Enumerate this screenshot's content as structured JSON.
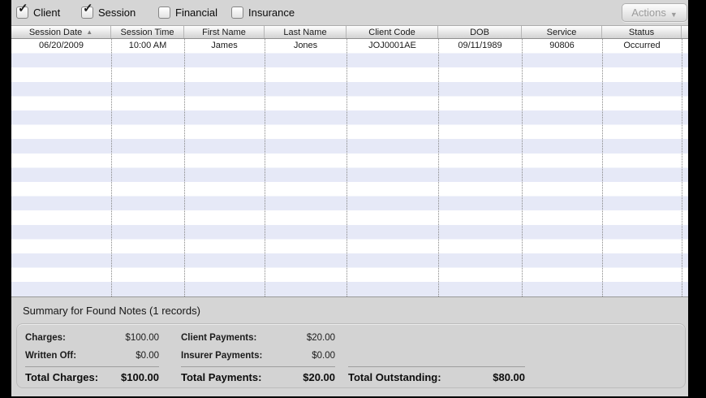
{
  "filters": {
    "check_glyph": "✓",
    "items": [
      {
        "label": "Client",
        "checked": true
      },
      {
        "label": "Session",
        "checked": true
      },
      {
        "label": "Financial",
        "checked": false
      },
      {
        "label": "Insurance",
        "checked": false
      }
    ],
    "actions_label": "Actions",
    "actions_arrow": "▼"
  },
  "table": {
    "columns": [
      "Session Date",
      "Session Time",
      "First Name",
      "Last Name",
      "Client Code",
      "DOB",
      "Service",
      "Status"
    ],
    "sort": {
      "column": "Session Date",
      "direction": "ascending",
      "icon": "▲"
    },
    "rows": [
      [
        "06/20/2009",
        "10:00 AM",
        "James",
        "Jones",
        "JOJ0001AE",
        "09/11/1989",
        "90806",
        "Occurred"
      ]
    ]
  },
  "summary": {
    "title": "Summary for Found Notes  (1 records)",
    "groups": [
      {
        "rows": [
          {
            "label": "Charges:",
            "value": "$100.00"
          },
          {
            "label": "Written Off:",
            "value": "$0.00"
          }
        ],
        "total": {
          "label": "Total Charges:",
          "value": "$100.00"
        }
      },
      {
        "rows": [
          {
            "label": "Client Payments:",
            "value": "$20.00"
          },
          {
            "label": "Insurer Payments:",
            "value": "$0.00"
          }
        ],
        "total": {
          "label": "Total Payments:",
          "value": "$20.00"
        }
      },
      {
        "rows": [],
        "total": {
          "label": "Total Outstanding:",
          "value": "$80.00"
        }
      }
    ]
  },
  "colors": {
    "chrome-bg": "#d5d5d5",
    "stripe": "#e6e9f7",
    "row-text": "#1a1a1a",
    "disabled-text": "#9b9b9b"
  }
}
